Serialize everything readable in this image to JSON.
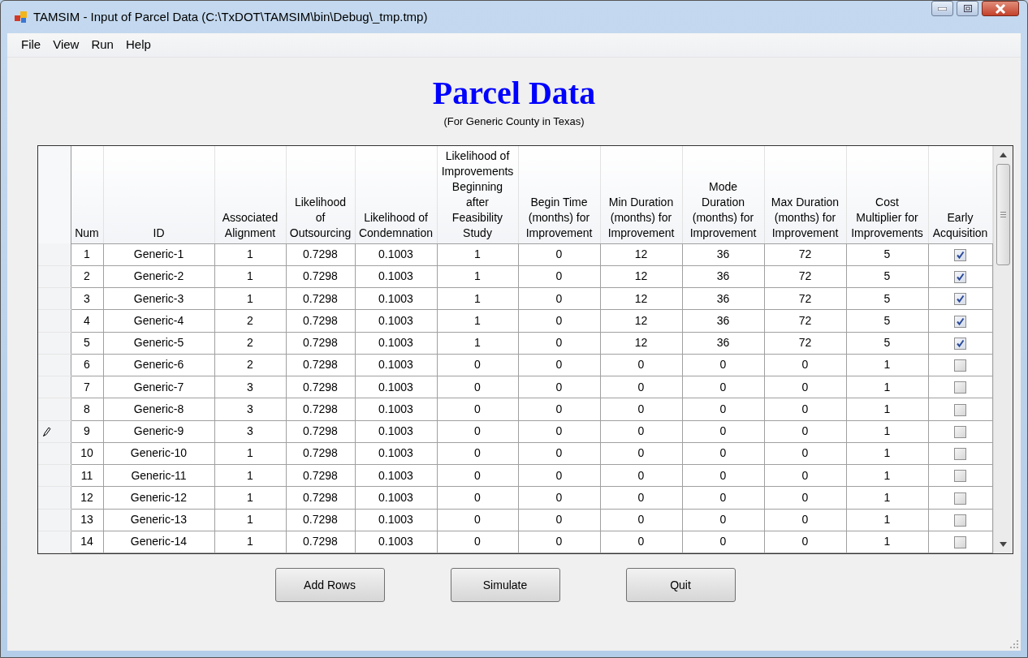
{
  "window": {
    "title": "TAMSIM - Input of Parcel Data (C:\\TxDOT\\TAMSIM\\bin\\Debug\\_tmp.tmp)"
  },
  "menu": [
    "File",
    "View",
    "Run",
    "Help"
  ],
  "heading": "Parcel Data",
  "subheading": "(For Generic County in Texas)",
  "table": {
    "columns": [
      {
        "lines": [
          "Num"
        ]
      },
      {
        "lines": [
          "ID"
        ]
      },
      {
        "lines": [
          "Associated",
          "Alignment"
        ]
      },
      {
        "lines": [
          "Likelihood",
          "of",
          "Outsourcing"
        ]
      },
      {
        "lines": [
          "Likelihood of",
          "Condemnation"
        ]
      },
      {
        "lines": [
          "Likelihood of",
          "Improvements",
          "Beginning",
          "after",
          "Feasibility",
          "Study"
        ]
      },
      {
        "lines": [
          "Begin Time",
          "(months) for",
          "Improvement"
        ]
      },
      {
        "lines": [
          "Min Duration",
          "(months) for",
          "Improvement"
        ]
      },
      {
        "lines": [
          "Mode",
          "Duration",
          "(months) for",
          "Improvement"
        ]
      },
      {
        "lines": [
          "Max Duration",
          "(months) for",
          "Improvement"
        ]
      },
      {
        "lines": [
          "Cost",
          "Multiplier for",
          "Improvements"
        ]
      },
      {
        "lines": [
          "Early",
          "Acquisition"
        ]
      }
    ],
    "rows": [
      {
        "cells": [
          "1",
          "Generic-1",
          "1",
          "0.7298",
          "0.1003",
          "1",
          "0",
          "12",
          "36",
          "72",
          "5"
        ],
        "early_acquisition": true,
        "editing": false
      },
      {
        "cells": [
          "2",
          "Generic-2",
          "1",
          "0.7298",
          "0.1003",
          "1",
          "0",
          "12",
          "36",
          "72",
          "5"
        ],
        "early_acquisition": true,
        "editing": false
      },
      {
        "cells": [
          "3",
          "Generic-3",
          "1",
          "0.7298",
          "0.1003",
          "1",
          "0",
          "12",
          "36",
          "72",
          "5"
        ],
        "early_acquisition": true,
        "editing": false
      },
      {
        "cells": [
          "4",
          "Generic-4",
          "2",
          "0.7298",
          "0.1003",
          "1",
          "0",
          "12",
          "36",
          "72",
          "5"
        ],
        "early_acquisition": true,
        "editing": false
      },
      {
        "cells": [
          "5",
          "Generic-5",
          "2",
          "0.7298",
          "0.1003",
          "1",
          "0",
          "12",
          "36",
          "72",
          "5"
        ],
        "early_acquisition": true,
        "editing": false
      },
      {
        "cells": [
          "6",
          "Generic-6",
          "2",
          "0.7298",
          "0.1003",
          "0",
          "0",
          "0",
          "0",
          "0",
          "1"
        ],
        "early_acquisition": false,
        "editing": false
      },
      {
        "cells": [
          "7",
          "Generic-7",
          "3",
          "0.7298",
          "0.1003",
          "0",
          "0",
          "0",
          "0",
          "0",
          "1"
        ],
        "early_acquisition": false,
        "editing": false
      },
      {
        "cells": [
          "8",
          "Generic-8",
          "3",
          "0.7298",
          "0.1003",
          "0",
          "0",
          "0",
          "0",
          "0",
          "1"
        ],
        "early_acquisition": false,
        "editing": false
      },
      {
        "cells": [
          "9",
          "Generic-9",
          "3",
          "0.7298",
          "0.1003",
          "0",
          "0",
          "0",
          "0",
          "0",
          "1"
        ],
        "early_acquisition": false,
        "editing": true
      },
      {
        "cells": [
          "10",
          "Generic-10",
          "1",
          "0.7298",
          "0.1003",
          "0",
          "0",
          "0",
          "0",
          "0",
          "1"
        ],
        "early_acquisition": false,
        "editing": false
      },
      {
        "cells": [
          "11",
          "Generic-11",
          "1",
          "0.7298",
          "0.1003",
          "0",
          "0",
          "0",
          "0",
          "0",
          "1"
        ],
        "early_acquisition": false,
        "editing": false
      },
      {
        "cells": [
          "12",
          "Generic-12",
          "1",
          "0.7298",
          "0.1003",
          "0",
          "0",
          "0",
          "0",
          "0",
          "1"
        ],
        "early_acquisition": false,
        "editing": false
      },
      {
        "cells": [
          "13",
          "Generic-13",
          "1",
          "0.7298",
          "0.1003",
          "0",
          "0",
          "0",
          "0",
          "0",
          "1"
        ],
        "early_acquisition": false,
        "editing": false
      },
      {
        "cells": [
          "14",
          "Generic-14",
          "1",
          "0.7298",
          "0.1003",
          "0",
          "0",
          "0",
          "0",
          "0",
          "1"
        ],
        "early_acquisition": false,
        "editing": false
      }
    ]
  },
  "buttons": [
    "Add Rows",
    "Simulate",
    "Quit"
  ]
}
